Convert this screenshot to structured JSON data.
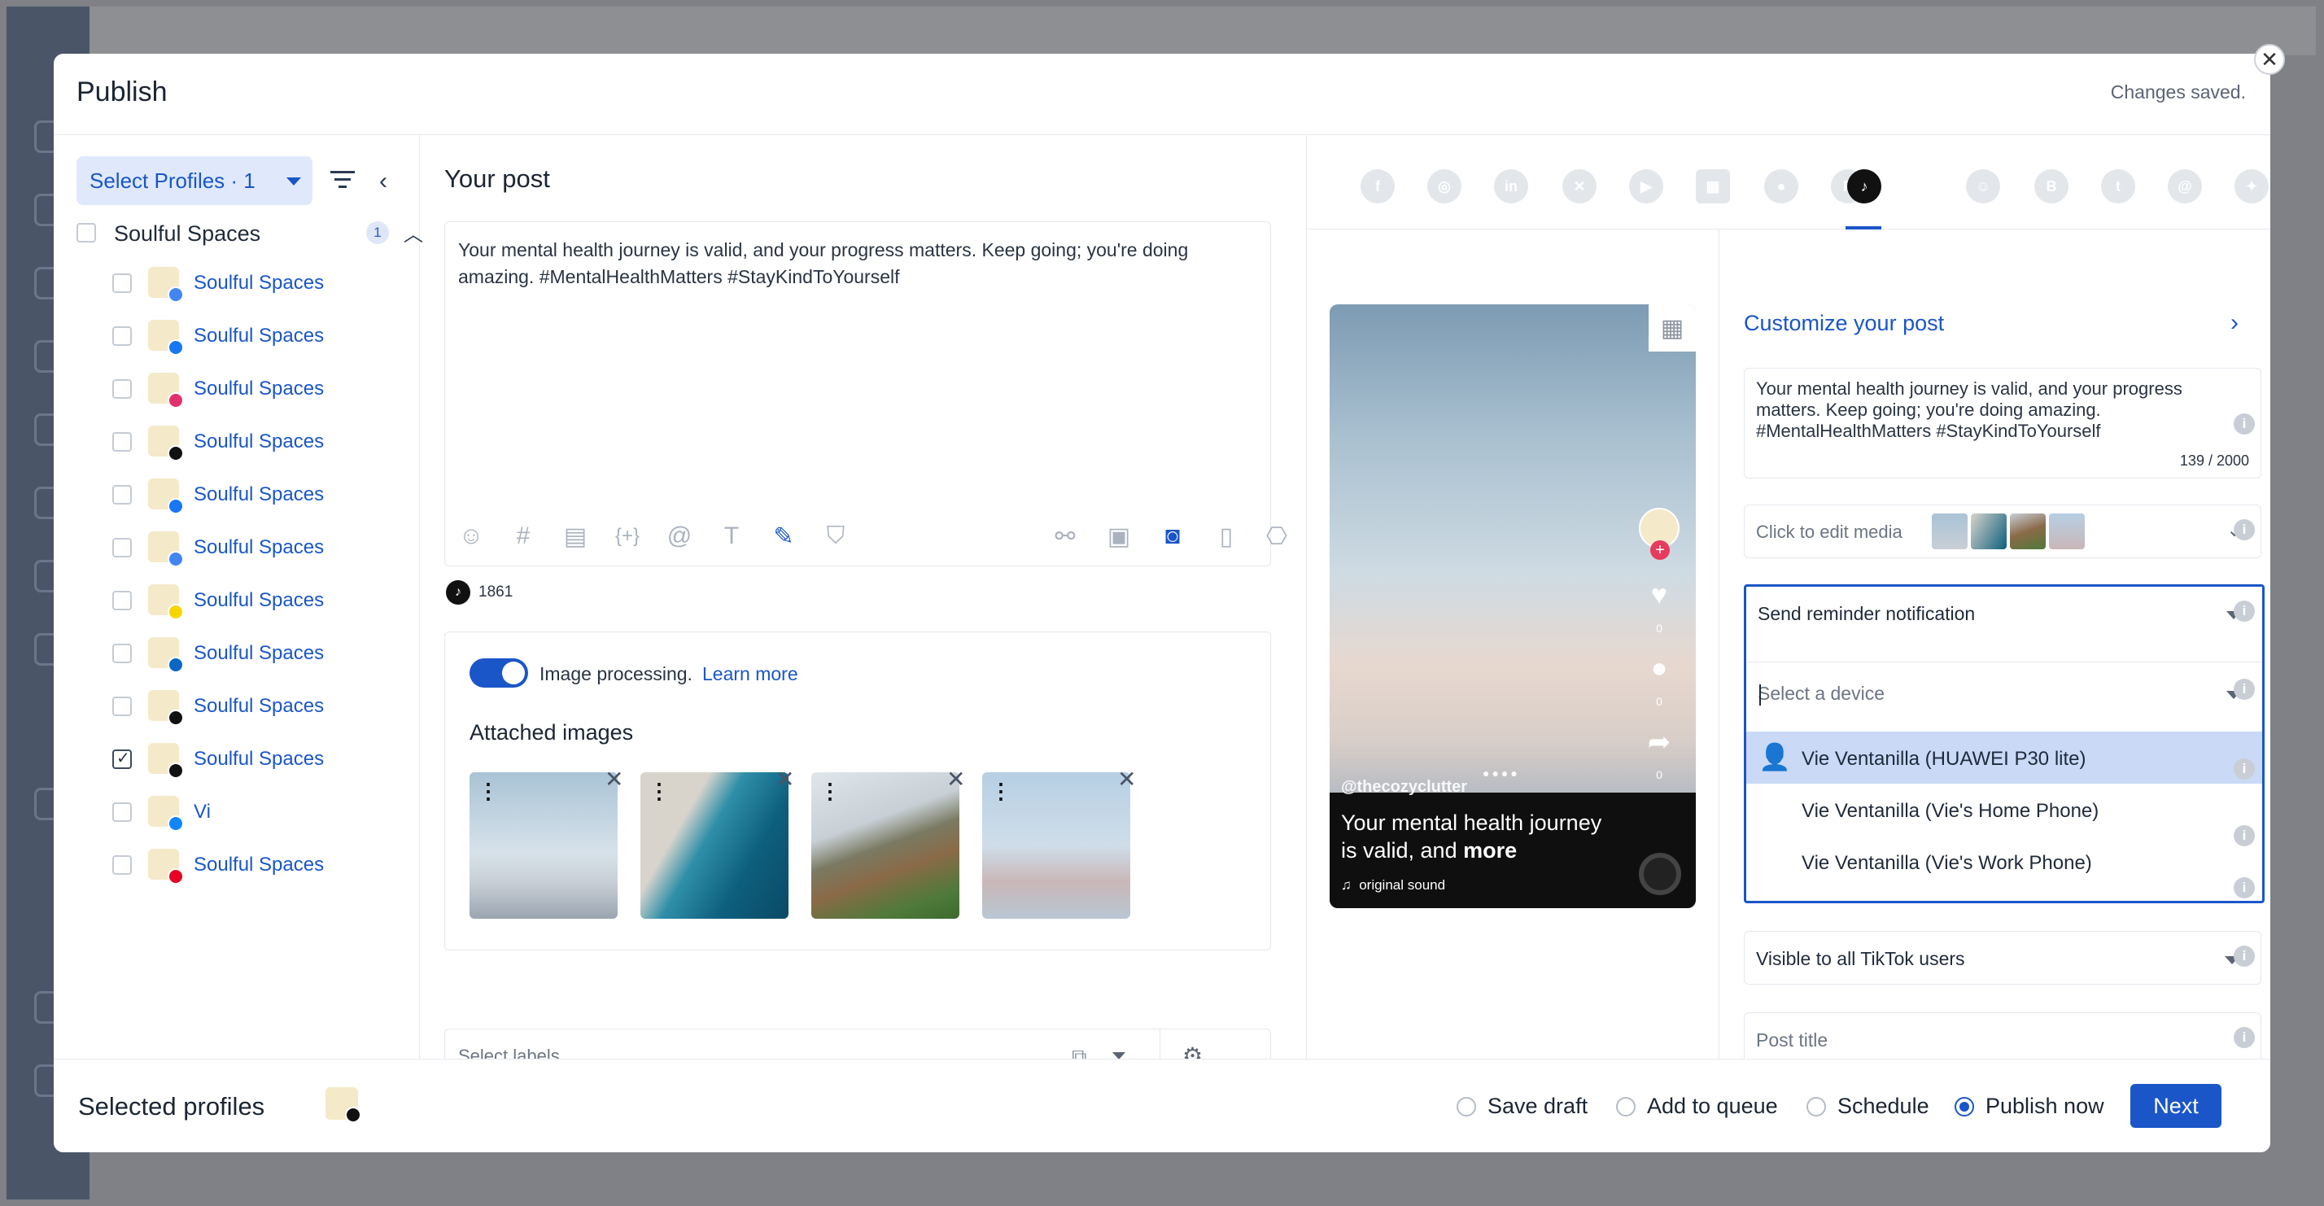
{
  "header": {
    "title": "Publish",
    "status": "Changes saved."
  },
  "left": {
    "select_profiles": "Select Profiles · 1",
    "group": {
      "name": "Soulful Spaces",
      "count": "1"
    },
    "profiles": [
      {
        "name": "Soulful Spaces",
        "network": "google-business",
        "checked": false
      },
      {
        "name": "Soulful Spaces",
        "network": "facebook",
        "checked": false
      },
      {
        "name": "Soulful Spaces",
        "network": "instagram",
        "checked": false
      },
      {
        "name": "Soulful Spaces",
        "network": "x",
        "checked": false
      },
      {
        "name": "Soulful Spaces",
        "network": "facebook",
        "checked": false
      },
      {
        "name": "Soulful Spaces",
        "network": "google-business",
        "checked": false
      },
      {
        "name": "Soulful Spaces",
        "network": "snapchat",
        "checked": false
      },
      {
        "name": "Soulful Spaces",
        "network": "linkedin",
        "checked": false
      },
      {
        "name": "Soulful Spaces",
        "network": "threads",
        "checked": false
      },
      {
        "name": "Soulful Spaces",
        "network": "tiktok",
        "checked": true
      },
      {
        "name": "Vi",
        "network": "bluesky",
        "checked": false
      },
      {
        "name": "Soulful Spaces",
        "network": "pinterest",
        "checked": false
      }
    ]
  },
  "middle": {
    "title": "Your post",
    "post_text": "Your mental health journey is valid, and your progress matters. Keep going; you're doing amazing. #MentalHealthMatters #StayKindToYourself",
    "char_count": "1861",
    "image_processing_label": "Image processing.",
    "learn_more": "Learn more",
    "attached_title": "Attached images",
    "labels_placeholder": "Select labels"
  },
  "preview": {
    "handle": "@thecozyclutter",
    "caption": "Your mental health journey is valid, and",
    "more": "more",
    "sound": "original sound",
    "counts": [
      "0",
      "0",
      "0"
    ]
  },
  "customize": {
    "title": "Customize your post",
    "text": "Your mental health journey is valid, and your progress matters. Keep going; you're doing amazing. #MentalHealthMatters #StayKindToYourself",
    "count": "139 / 2000",
    "media_placeholder": "Click to edit media",
    "reminder": "Send reminder notification",
    "device_placeholder": "Select a device",
    "devices": [
      "Vie Ventanilla (HUAWEI P30 lite)",
      "Vie Ventanilla (Vie's Home Phone)",
      "Vie Ventanilla (Vie's Work Phone)"
    ],
    "visibility": "Visible to all TikTok users",
    "post_title_placeholder": "Post title"
  },
  "footer": {
    "title": "Selected profiles",
    "options": [
      "Save draft",
      "Add to queue",
      "Schedule",
      "Publish now"
    ],
    "selected_option": "Publish now",
    "next": "Next"
  },
  "colors": {
    "accent": "#1a56c8",
    "selected_row": "#c9d9f6"
  }
}
